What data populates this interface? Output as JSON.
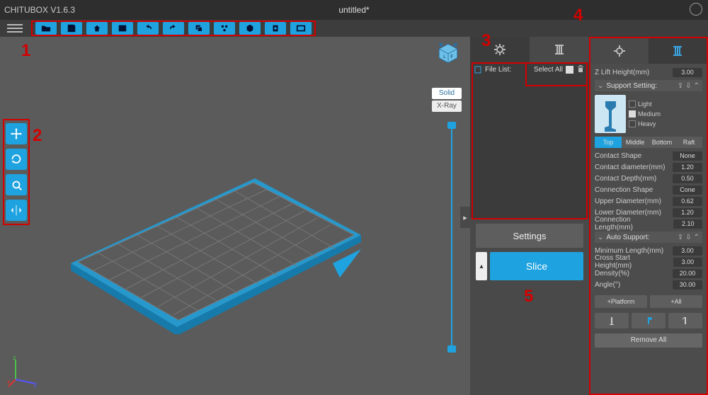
{
  "app": {
    "title": "CHITUBOX V1.6.3",
    "document": "untitled*"
  },
  "top_toolbar": {
    "buttons": [
      "open",
      "save",
      "save-as",
      "import",
      "undo",
      "redo",
      "auto-layout",
      "hollow",
      "dig-hole",
      "screenshot",
      "expand"
    ]
  },
  "left_tools": [
    "move",
    "rotate",
    "scale",
    "mirror"
  ],
  "render_modes": {
    "solid": "Solid",
    "xray": "X-Ray"
  },
  "right_panel": {
    "tabs": {
      "settings_icon": "settings-gear",
      "support_icon": "pillar"
    },
    "file_list": {
      "label": "File List:",
      "select_all": "Select All"
    },
    "settings_btn": "Settings",
    "slice_btn": "Slice"
  },
  "support": {
    "z_lift": {
      "label": "Z Lift Height(mm)",
      "value": "3.00"
    },
    "support_setting": "Support Setting:",
    "weights": {
      "light": "Light",
      "medium": "Medium",
      "heavy": "Heavy"
    },
    "seg": {
      "top": "Top",
      "middle": "Middle",
      "bottom": "Bottom",
      "raft": "Raft"
    },
    "params_top": [
      {
        "label": "Contact Shape",
        "value": "None"
      },
      {
        "label": "Contact diameter(mm)",
        "value": "1.20"
      },
      {
        "label": "Contact Depth(mm)",
        "value": "0.50"
      },
      {
        "label": "Connection Shape",
        "value": "Cone"
      },
      {
        "label": "Upper Diameter(mm)",
        "value": "0.62"
      },
      {
        "label": "Lower Diameter(mm)",
        "value": "1.20"
      },
      {
        "label": "Connection Length(mm)",
        "value": "2.10"
      }
    ],
    "auto_support": "Auto Support:",
    "params_auto": [
      {
        "label": "Minimum Length(mm)",
        "value": "3.00"
      },
      {
        "label": "Cross Start Height(mm)",
        "value": "3.00"
      },
      {
        "label": "Density(%)",
        "value": "20.00"
      },
      {
        "label": "Angle(°)",
        "value": "30.00"
      }
    ],
    "platform_btn": "+Platform",
    "all_btn": "+All",
    "remove_all": "Remove All"
  },
  "annotations": {
    "n1": "1",
    "n2": "2",
    "n3": "3",
    "n4": "4",
    "n5": "5"
  }
}
